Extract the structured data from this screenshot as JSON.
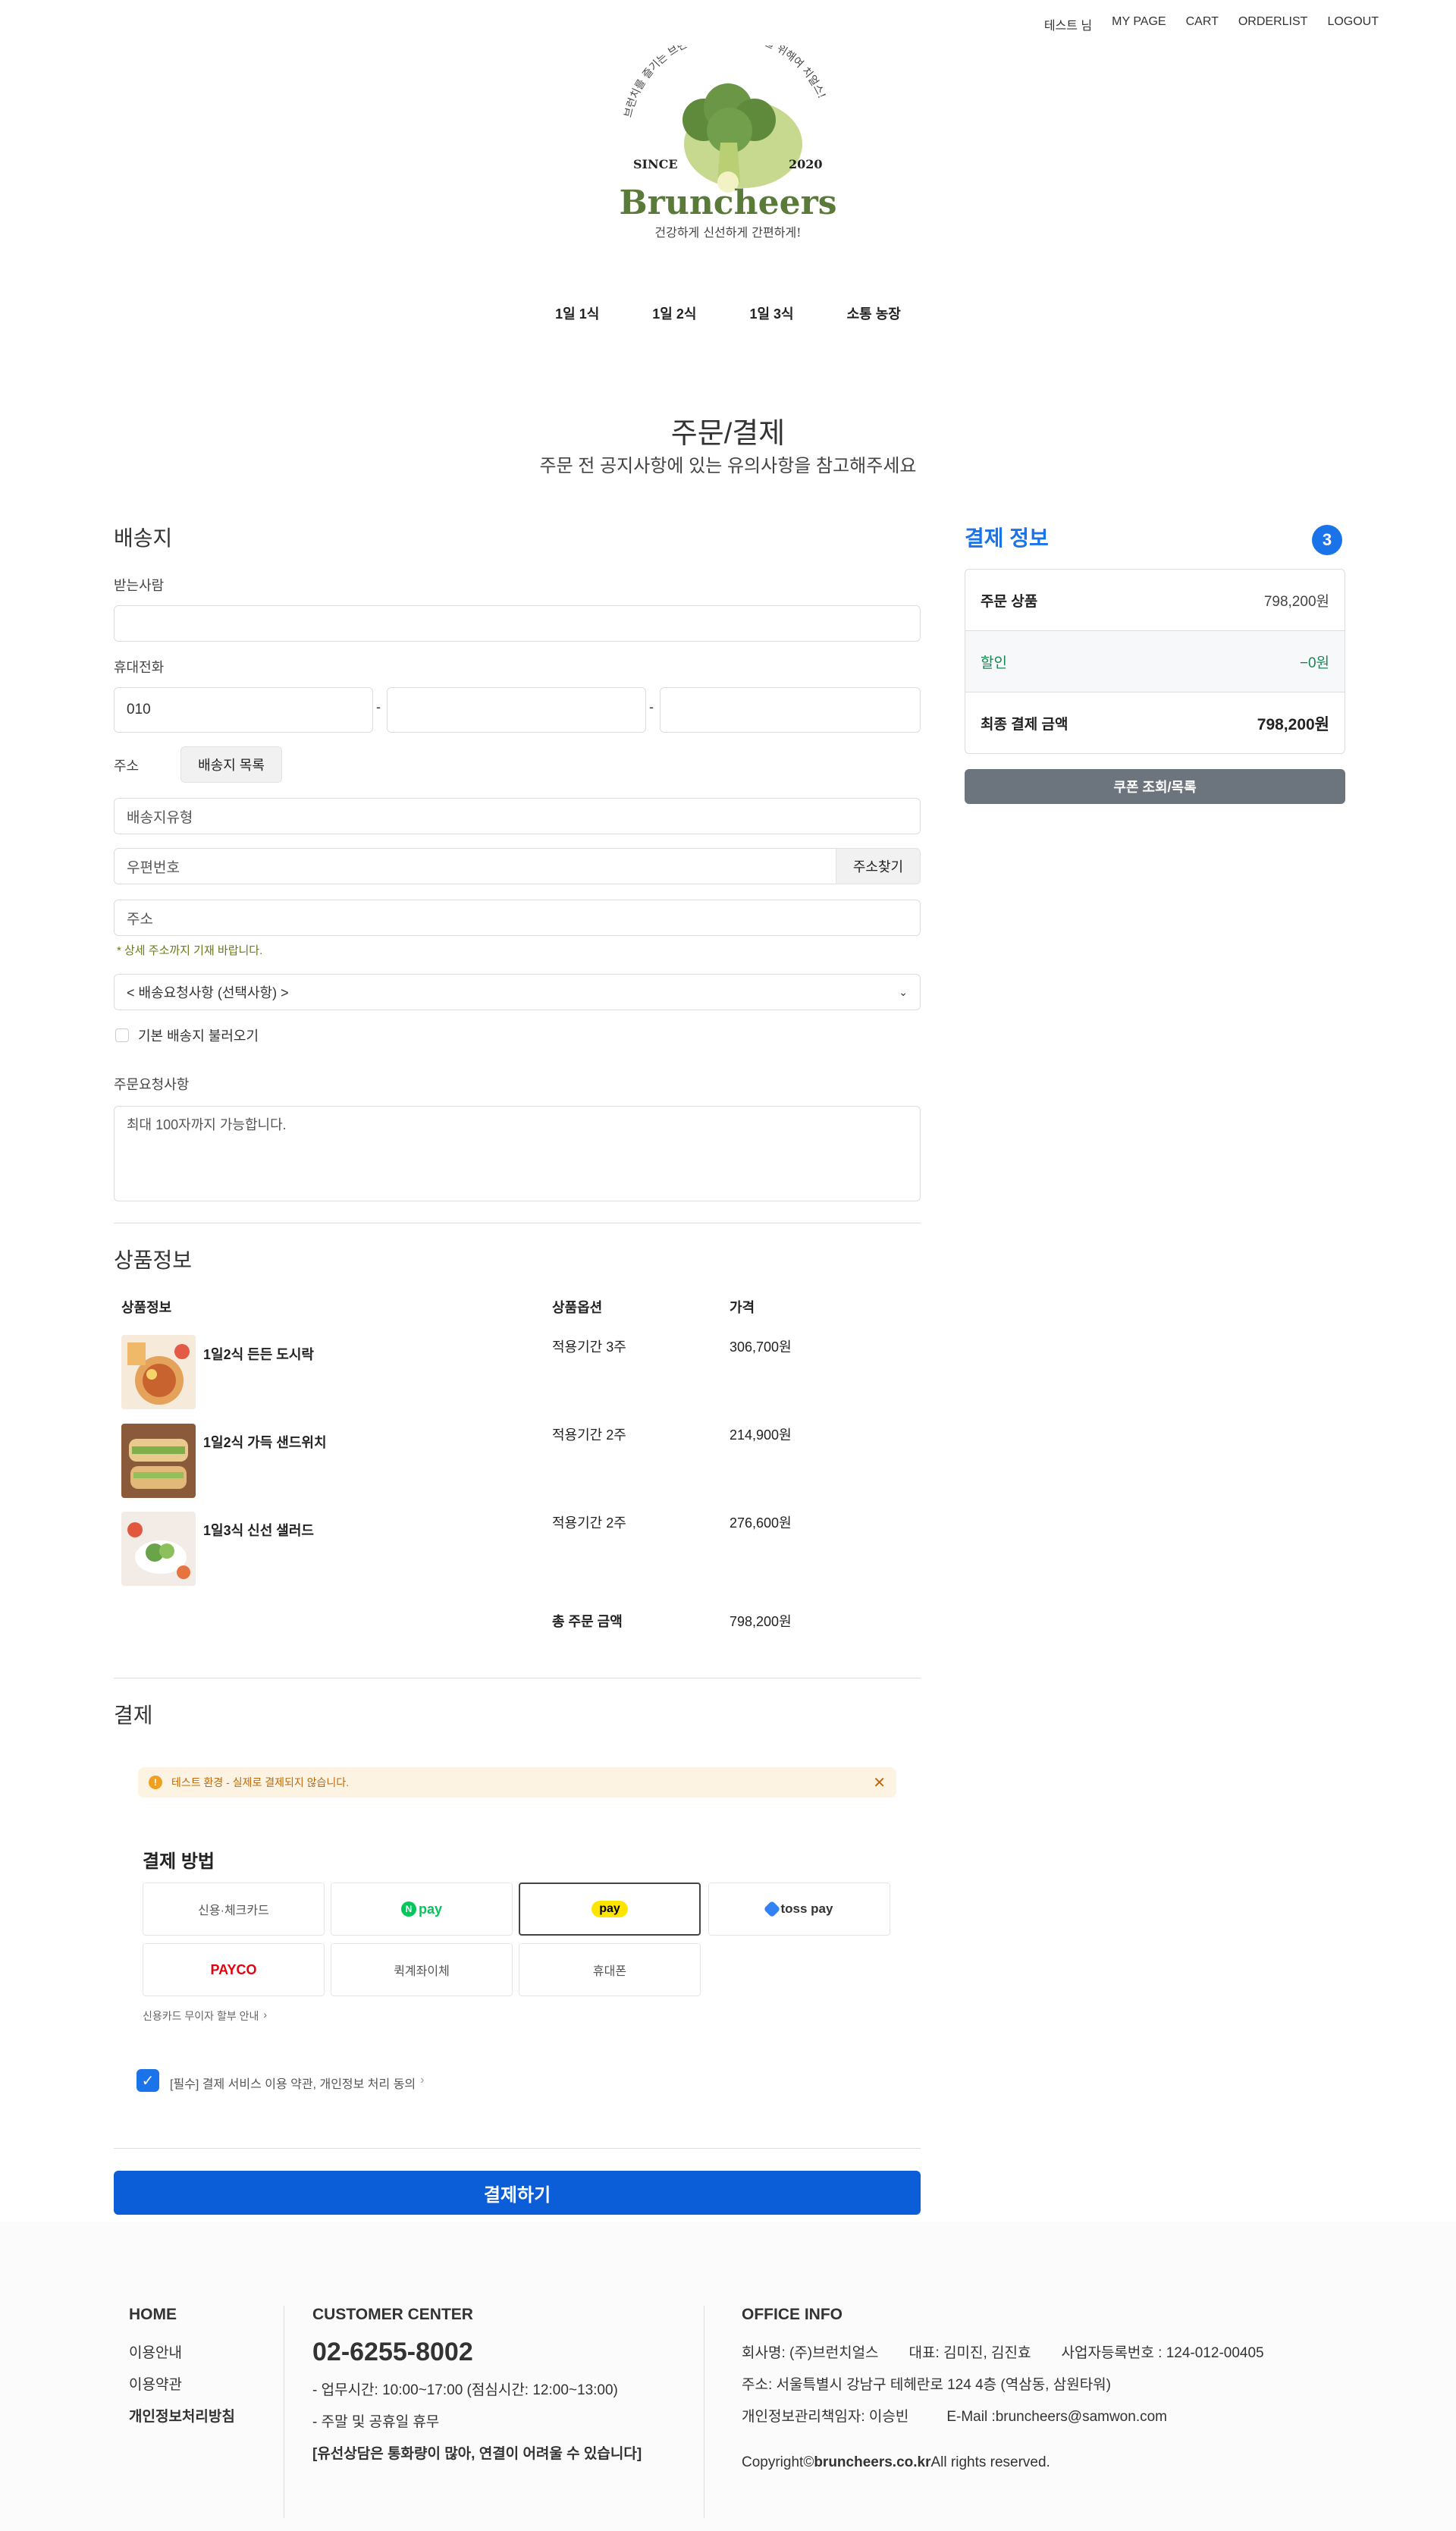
{
  "top_nav": [
    "테스트 님",
    "MY PAGE",
    "CART",
    "ORDERLIST",
    "LOGOUT"
  ],
  "logo": {
    "arc_text": "브런치를 즐기는 브런치어, 당신의 건강을 위해여 치얼스!",
    "since": "SINCE",
    "year": "2020",
    "brand": "Bruncheers",
    "tagline": "건강하게 신선하게 간편하게!"
  },
  "main_nav": [
    "1일 1식",
    "1일 2식",
    "1일 3식",
    "소통 농장"
  ],
  "page": {
    "title": "주문/결제",
    "subtitle": "주문 전 공지사항에 있는 유의사항을 참고해주세요"
  },
  "shipping": {
    "title": "배송지",
    "recipient_label": "받는사람",
    "recipient_value": "",
    "phone_label": "휴대전화",
    "phone_prefix": "010",
    "phone_sep": "-",
    "address_label": "주소",
    "address_list_button": "배송지 목록",
    "type_placeholder": "배송지유형",
    "zip_placeholder": "우편번호",
    "find_address_button": "주소찾기",
    "address_placeholder": "주소",
    "detail_hint": "* 상세 주소까지 기재 바랍니다.",
    "request_select": "< 배송요청사항 (선택사항) >",
    "default_checkbox": "기본 배송지 불러오기",
    "order_request_label": "주문요청사항",
    "order_request_placeholder": "최대 100자까지 가능합니다."
  },
  "products": {
    "title": "상품정보",
    "headers": {
      "info": "상품정보",
      "option": "상품옵션",
      "price": "가격"
    },
    "items": [
      {
        "name": "1일2식 든든 도시락",
        "option": "적용기간 3주",
        "price": "306,700원"
      },
      {
        "name": "1일2식 가득 샌드위치",
        "option": "적용기간 2주",
        "price": "214,900원"
      },
      {
        "name": "1일3식 신선 샐러드",
        "option": "적용기간 2주",
        "price": "276,600원"
      }
    ],
    "total_label": "총 주문 금액",
    "total_value": "798,200원"
  },
  "payment": {
    "title": "결제",
    "notice": "테스트 환경 - 실제로 결제되지 않습니다.",
    "method_title": "결제 방법",
    "methods": [
      "신용·체크카드",
      "N pay",
      "pay",
      "toss pay",
      "PAYCO",
      "퀵계좌이체",
      "휴대폰"
    ],
    "installment_link": "신용카드 무이자 할부 안내",
    "agree_text": "[필수] 결제 서비스 이용 약관, 개인정보 처리 동의",
    "submit_button": "결제하기"
  },
  "summary": {
    "title": "결제 정보",
    "badge": "3",
    "rows": [
      {
        "label": "주문 상품",
        "value": "798,200원"
      },
      {
        "label": "할인",
        "value": "−0원"
      },
      {
        "label": "최종 결제 금액",
        "value": "798,200원"
      }
    ],
    "coupon_button": "쿠폰 조회/목록"
  },
  "footer": {
    "home": {
      "title": "HOME",
      "links": [
        "이용안내",
        "이용약관",
        "개인정보처리방침"
      ]
    },
    "cs": {
      "title": "CUSTOMER CENTER",
      "phone": "02-6255-8002",
      "hours": "- 업무시간: 10:00~17:00 (점심시간: 12:00~13:00)",
      "holiday": "- 주말 및 공휴일 휴무",
      "notice": "[유선상담은 통화량이 많아, 연결이 어려울 수 있습니다]"
    },
    "office": {
      "title": "OFFICE INFO",
      "company": "회사명: (주)브런치얼스",
      "ceo": "대표: 김미진, 김진효",
      "bizno": "사업자등록번호 : 124-012-00405",
      "address": "주소: 서울특별시 강남구 테헤란로 124 4층 (역삼동, 삼원타워)",
      "privacy": "개인정보관리책임자: 이승빈",
      "email": "E-Mail :bruncheers@samwon.com",
      "copyright_prefix": "Copyright©",
      "copyright_domain": "bruncheers.co.kr",
      "copyright_suffix": "All rights reserved."
    }
  },
  "colors": {
    "accent_blue": "#1a73e8",
    "submit_blue": "#0b5ed7",
    "coupon_gray": "#6c757d",
    "brand_green": "#5a7a3a",
    "discount_green": "#198754"
  }
}
